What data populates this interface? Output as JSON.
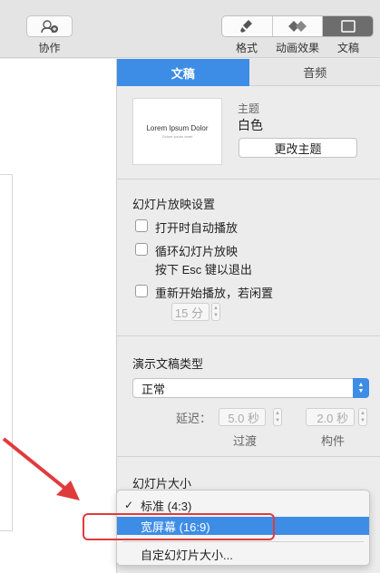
{
  "toolbar": {
    "collaborate_label": "协作",
    "format_label": "格式",
    "animate_label": "动画效果",
    "document_label": "文稿"
  },
  "tabs": {
    "document": "文稿",
    "audio": "音频"
  },
  "theme": {
    "thumb_title": "Lorem Ipsum Dolor",
    "thumb_subtitle": "Dolore ipsum amet",
    "section_label": "主题",
    "current": "白色",
    "change_button": "更改主题"
  },
  "slideshow": {
    "title": "幻灯片放映设置",
    "autoplay": "打开时自动播放",
    "loop": "循环幻灯片放映",
    "esc_hint": "按下 Esc 键以退出",
    "restart": "重新开始播放，若闲置",
    "idle_value": "15 分"
  },
  "presentation_type": {
    "title": "演示文稿类型",
    "selected": "正常",
    "delay_label": "延迟：",
    "transition_value": "5.0 秒",
    "build_value": "2.0 秒",
    "transition_label": "过渡",
    "build_label": "构件"
  },
  "slide_size": {
    "title": "幻灯片大小",
    "options": [
      "标准 (4:3)",
      "宽屏幕 (16:9)",
      "自定幻灯片大小..."
    ],
    "checked_index": 0,
    "highlighted_index": 1
  },
  "colors": {
    "accent": "#3d8de6",
    "annotation": "#e03b3b"
  }
}
